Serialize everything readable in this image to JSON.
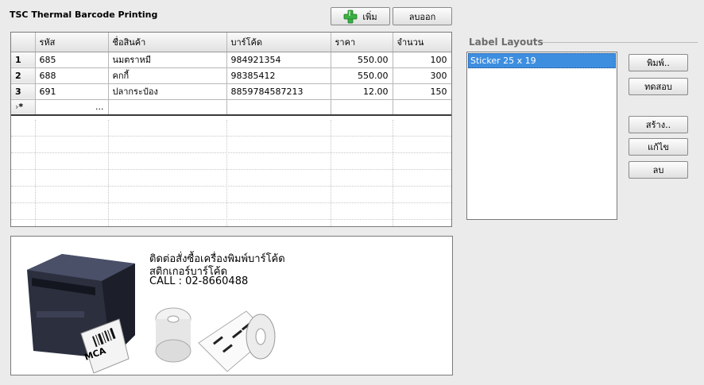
{
  "app": {
    "title": "TSC Thermal Barcode Printing"
  },
  "toolbar": {
    "add_label": "เพิ่ม",
    "delete_label": "ลบออก"
  },
  "grid": {
    "columns": [
      "รหัส",
      "ชื่อสินค้า",
      "บาร์โค้ด",
      "ราคา",
      "จำนวน"
    ],
    "rows": [
      {
        "index": "1",
        "code": "685",
        "name": "นมตราหมี",
        "barcode": "984921354",
        "price": "550.00",
        "qty": "100"
      },
      {
        "index": "2",
        "code": "688",
        "name": "คกกี้",
        "barcode": "98385412",
        "price": "550.00",
        "qty": "300"
      },
      {
        "index": "3",
        "code": "691",
        "name": "ปลากระป๋อง",
        "barcode": "8859784587213",
        "price": "12.00",
        "qty": "150"
      }
    ],
    "new_row_marker": "*",
    "new_row_ellipsis": "..."
  },
  "ad": {
    "line1": "ติดต่อสั่งซื้อเครื่องพิมพ์บาร์โค้ด",
    "line2": "สติกเกอร์บาร์โค้ด",
    "line3": "CALL : 02-8660488",
    "label_mca": "MCA"
  },
  "layouts": {
    "title": "Label Layouts",
    "items": [
      "Sticker 25 x 19"
    ],
    "buttons": {
      "print": "พิมพ์..",
      "test": "ทดสอบ",
      "create": "สร้าง..",
      "edit": "แก้ไข",
      "delete": "ลบ"
    }
  },
  "colors": {
    "accent": "#3e8ee0",
    "plus_green": "#3cb043"
  }
}
